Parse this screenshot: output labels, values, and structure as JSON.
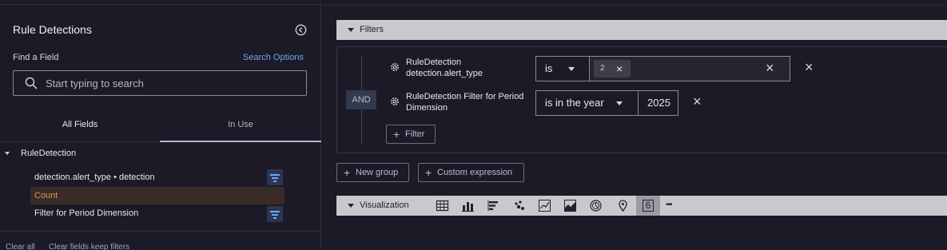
{
  "left_panel": {
    "title": "Rule Detections",
    "find_label": "Find a Field",
    "search_options": "Search Options",
    "search_placeholder": "Start typing to search",
    "tabs": {
      "all": "All Fields",
      "in_use": "In Use"
    },
    "tree": {
      "root": "RuleDetection",
      "fields": [
        {
          "label": "detection.alert_type • detection"
        },
        {
          "label": "Count"
        },
        {
          "label": "Filter for Period Dimension"
        }
      ]
    },
    "footer": {
      "clear_all": "Clear all",
      "clear_keep": "Clear fields keep filters"
    }
  },
  "filters": {
    "header": "Filters",
    "and_label": "AND",
    "rows": [
      {
        "field": "RuleDetection detection.alert_type",
        "operator": "is",
        "value_chip": "2"
      },
      {
        "field": "RuleDetection Filter for Period Dimension",
        "operator": "is in the year",
        "value": "2025"
      }
    ],
    "add_filter": "Filter"
  },
  "actions": {
    "new_group": "New group",
    "custom_expression": "Custom expression"
  },
  "visualization": {
    "header": "Visualization",
    "icons": [
      "table-icon",
      "bar-chart-icon",
      "horizontal-bar-icon",
      "scatter-icon",
      "line-chart-icon",
      "area-chart-icon",
      "pie-chart-icon",
      "map-pin-icon",
      "single-value-icon",
      "more-icon"
    ],
    "active_icon": "single-value-icon",
    "single_value_glyph": "6",
    "more_glyph": "•••"
  },
  "colors": {
    "accent": "#6ea7f5",
    "bar_bg": "#c9c9cd",
    "count_text": "#d49a5a"
  }
}
